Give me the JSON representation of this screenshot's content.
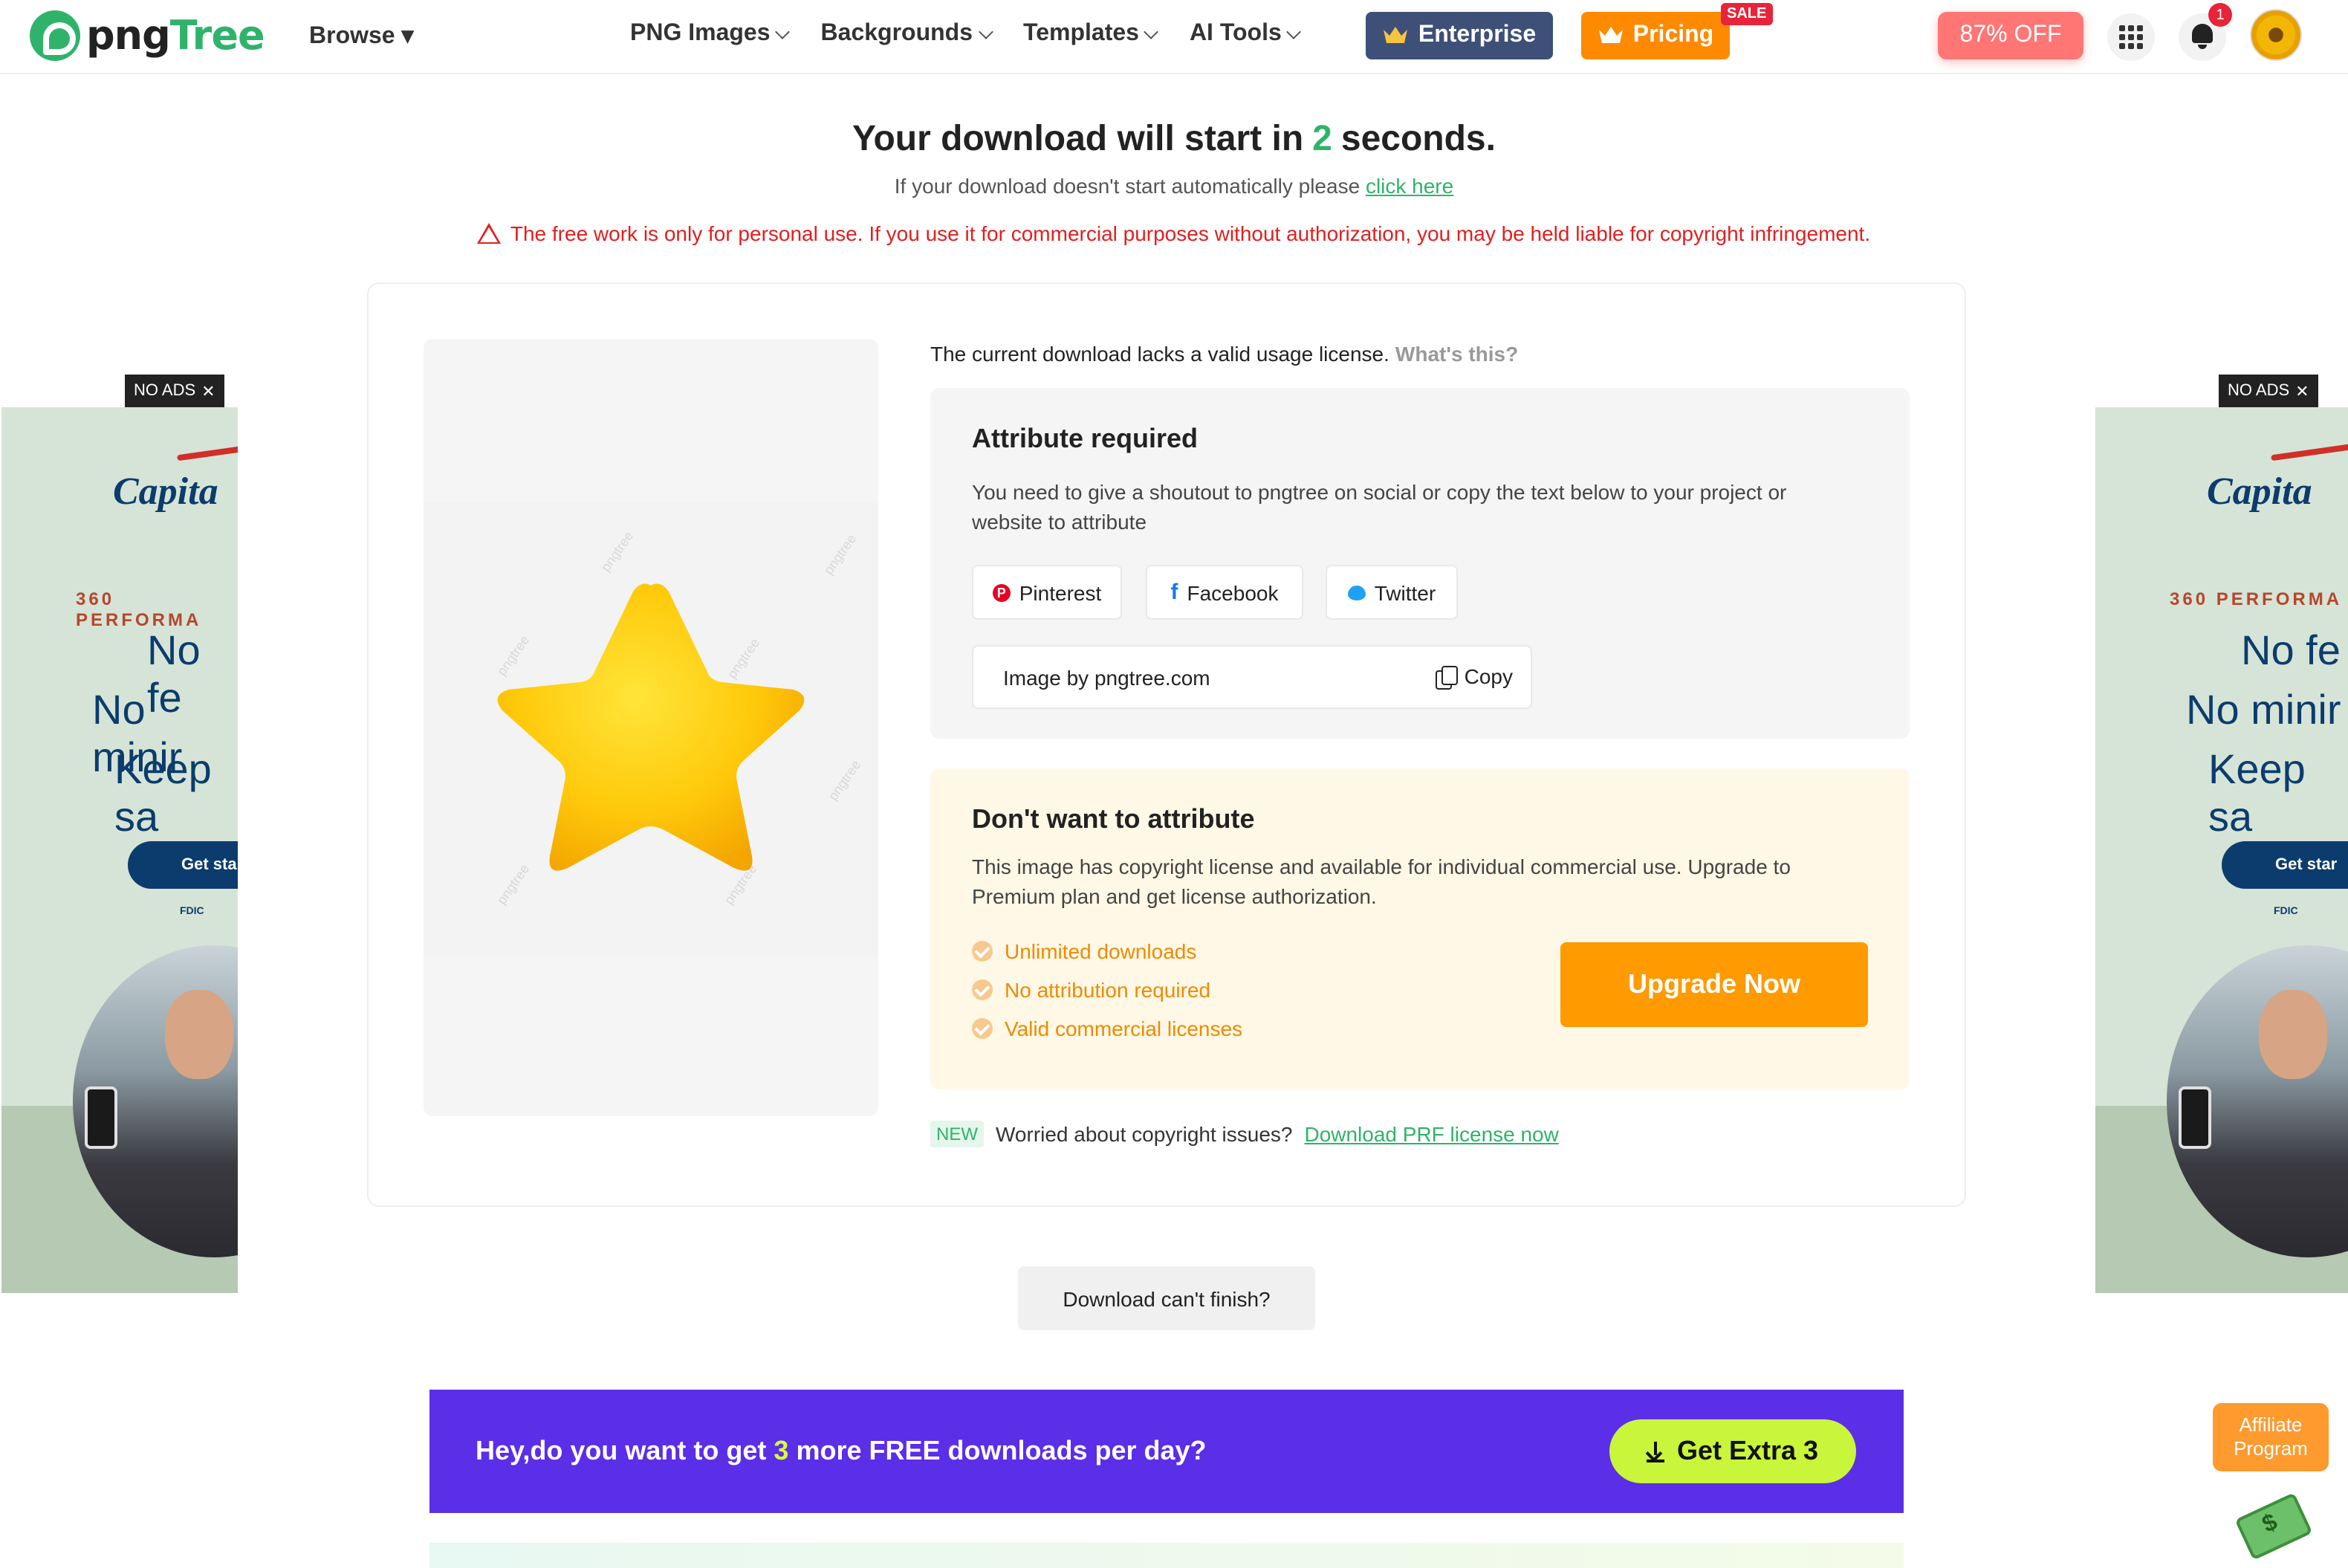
{
  "header": {
    "logo_part1": "png",
    "logo_part2": "Tree",
    "browse": "Browse ▾",
    "nav": [
      "PNG Images",
      "Backgrounds",
      "Templates",
      "AI Tools"
    ],
    "enterprise": "Enterprise",
    "pricing": "Pricing",
    "sale_badge": "SALE",
    "discount": "87% OFF",
    "notification_count": "1"
  },
  "download": {
    "title_before": "Your download will start in",
    "seconds": "2",
    "title_after": "seconds.",
    "fallback_text": "If your download doesn't start automatically please",
    "fallback_link": "click here",
    "warning": "The free work is only for personal use. If you use it for commercial purposes without authorization, you may be held liable for copyright infringement."
  },
  "license": {
    "notice": "The current download lacks a valid usage license.",
    "whats_this": "What's this?",
    "attribute_title": "Attribute required",
    "attribute_desc": "You need to give a shoutout to pngtree on social or copy the text below to your project or website to attribute",
    "social": [
      "Pinterest",
      "Facebook",
      "Twitter"
    ],
    "credit_text": "Image by pngtree.com",
    "copy_label": "Copy",
    "no_attr_title": "Don't want to attribute",
    "no_attr_desc": "This image has copyright license and available for individual commercial use. Upgrade to Premium plan and get license authorization.",
    "features": [
      "Unlimited downloads",
      "No attribution required",
      "Valid commercial licenses"
    ],
    "upgrade": "Upgrade Now",
    "new_badge": "NEW",
    "prf_text": "Worried about copyright issues?",
    "prf_link": "Download PRF license now"
  },
  "download_fail": "Download can't finish?",
  "promo": {
    "text_before": "Hey,do you want to get",
    "count": "3",
    "text_after": "more FREE downloads per day?",
    "button": "Get Extra 3"
  },
  "ads": {
    "no_ads": "NO ADS",
    "brand": "Capita",
    "tagline": "360 PERFORMA",
    "line1": "No fe",
    "line2": "No minir",
    "line3": "Keep sa",
    "cta": "Get star",
    "fdic": "FDIC"
  },
  "affiliate": {
    "line1": "Affiliate",
    "line2": "Program"
  },
  "colors": {
    "brand_green": "#2fb36b",
    "enterprise": "#3e5077",
    "pricing": "#ff8a00",
    "promo_bg": "#5b2ee8",
    "upgrade": "#ff9a00"
  }
}
